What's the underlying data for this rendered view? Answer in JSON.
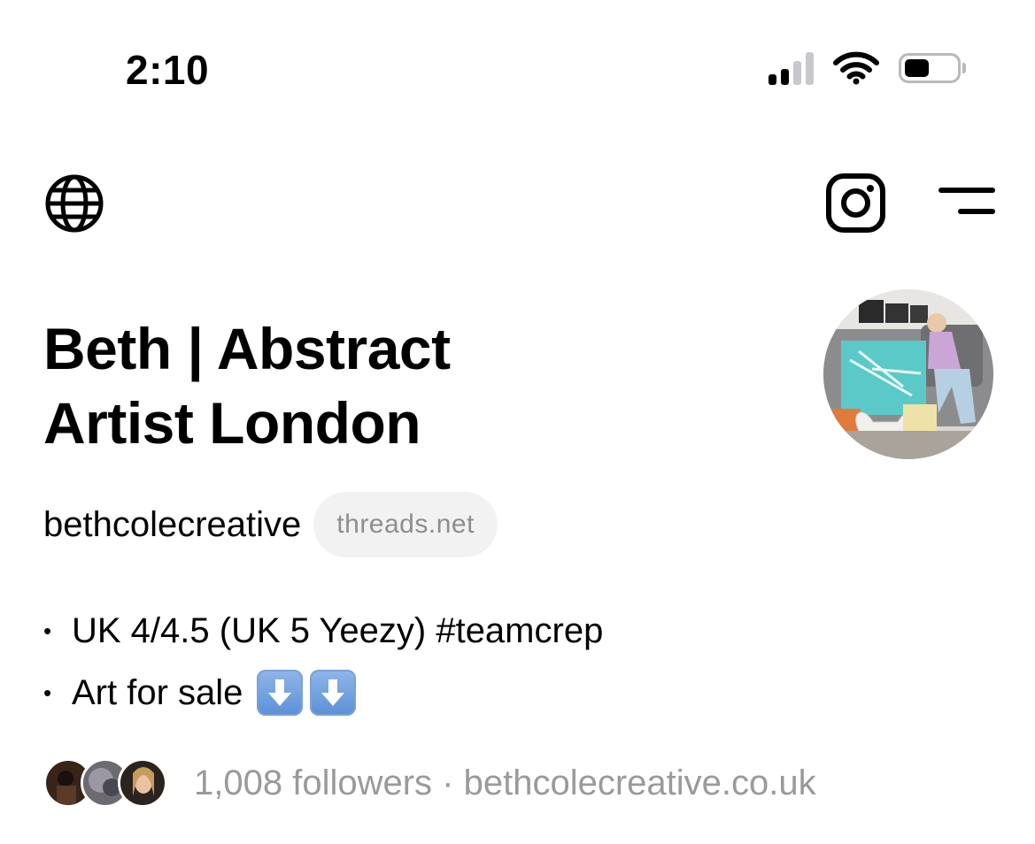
{
  "status_bar": {
    "time": "2:10",
    "icons": [
      "signal-icon",
      "wifi-icon",
      "battery-icon"
    ],
    "battery_level_fraction": 0.45
  },
  "nav": {
    "left_icon": "globe-icon",
    "right_icons": [
      "instagram-icon",
      "menu-icon"
    ]
  },
  "profile": {
    "name": "Beth | Abstract Artist London",
    "handle": "bethcolecreative",
    "domain_badge": "threads.net",
    "bio_lines": [
      "UK 4/4.5 (UK 5 Yeezy) #teamcrep",
      "Art for sale"
    ],
    "bio_emoji": [
      "down-arrow-emoji",
      "down-arrow-emoji"
    ],
    "followers_text": "1,008 followers",
    "separator": "·",
    "website": "bethcolecreative.co.uk"
  },
  "colors": {
    "text": "#000000",
    "muted": "#9a9a9a",
    "chip_bg": "#f2f2f2",
    "background": "#ffffff"
  }
}
